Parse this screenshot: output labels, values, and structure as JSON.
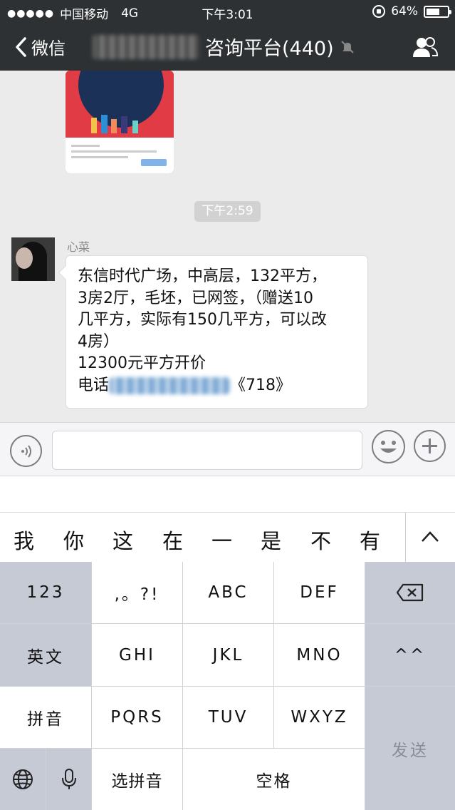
{
  "status_bar": {
    "carrier": "中国移动",
    "network": "4G",
    "time": "下午3:01",
    "battery": "64%",
    "battery_level": 0.64
  },
  "nav": {
    "back_label": "微信",
    "title_visible": "咨询平台(440)"
  },
  "chat": {
    "time_separator": "下午2:59",
    "message": {
      "sender": "心菜",
      "lines": [
        "东信时代广场，中高层，132平方，",
        "3房2厅，毛坯，已网签，（赠送10",
        "几平方，实际有150几平方，可以改",
        "4房）",
        "12300元平方开价"
      ],
      "phone_prefix": "电话",
      "phone_suffix": "《718》"
    }
  },
  "input": {
    "value": ""
  },
  "candidates": [
    "我",
    "你",
    "这",
    "在",
    "一",
    "是",
    "不",
    "有"
  ],
  "keyboard": {
    "numbers": "123",
    "punct": ",。?!",
    "abc": "ABC",
    "def": "DEF",
    "english": "英文",
    "ghi": "GHI",
    "jkl": "JKL",
    "mno": "MNO",
    "face": "^^",
    "pinyin": "拼音",
    "pqrs": "PQRS",
    "tuv": "TUV",
    "wxyz": "WXYZ",
    "send": "发送",
    "select_pinyin": "选拼音",
    "space": "空格"
  }
}
